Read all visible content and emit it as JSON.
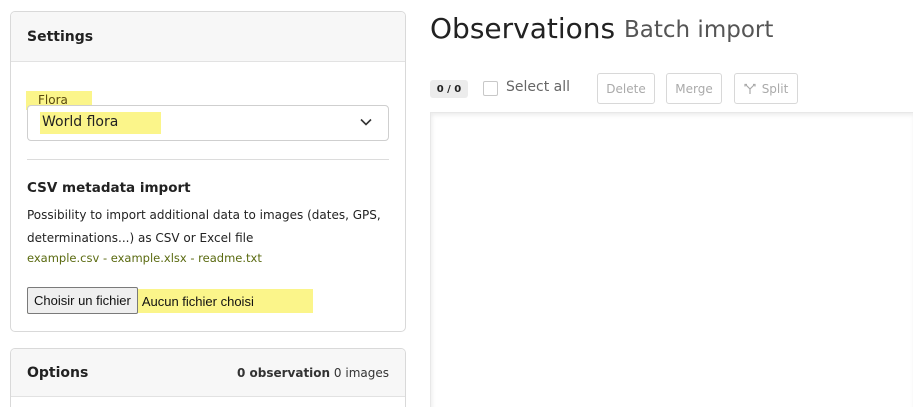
{
  "settings": {
    "header": "Settings",
    "flora_label": "Flora",
    "flora_value": "World flora",
    "csv_title": "CSV metadata import",
    "csv_description": "Possibility to import additional data to images (dates, GPS, determinations...) as CSV or Excel file",
    "links": [
      "example.csv",
      "example.xlsx",
      "readme.txt"
    ],
    "link_separator": "-",
    "file_button": "Choisir un fichier",
    "file_status": "Aucun fichier choisi"
  },
  "options": {
    "header": "Options",
    "observation_count": "0 observation",
    "image_count": "0 images"
  },
  "main": {
    "title": "Observations",
    "subtitle": "Batch import",
    "counter": "0 / 0",
    "select_all": "Select all",
    "delete": "Delete",
    "merge": "Merge",
    "split": "Split"
  },
  "icons": {
    "select_chevron": "chevron-down-icon",
    "split": "split-icon"
  },
  "colors": {
    "highlight": "#fbf58a",
    "link": "#5a6a10"
  }
}
